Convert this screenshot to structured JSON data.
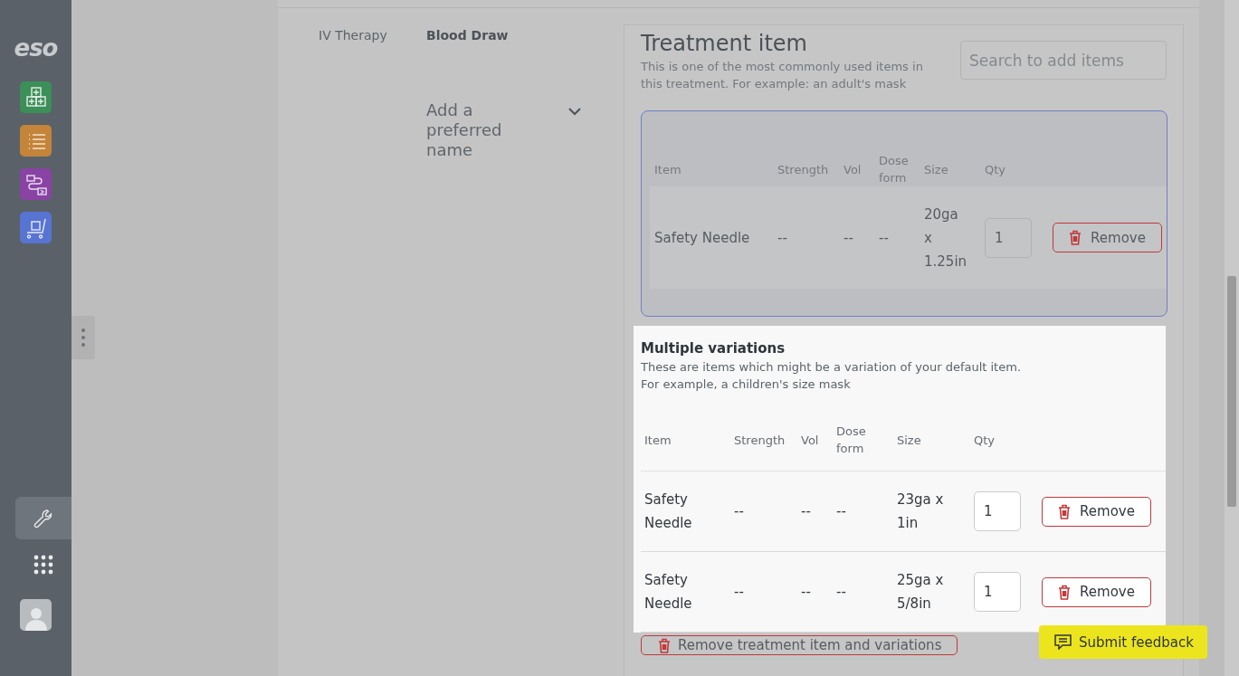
{
  "sidebar": {
    "logo": "eso",
    "apps": [
      {
        "kind": "boxes",
        "color": "#3c8f58"
      },
      {
        "kind": "list",
        "color": "#c4843a"
      },
      {
        "kind": "flow",
        "color": "#8843a3"
      },
      {
        "kind": "cart",
        "color": "#5874d2"
      }
    ],
    "tools": [
      {
        "kind": "wrench",
        "selected": true
      },
      {
        "kind": "grid",
        "selected": false
      }
    ]
  },
  "procedure": {
    "category": "IV Therapy",
    "name": "Blood Draw",
    "preferred_name_dropdown": {
      "placeholder": "Add a preferred name"
    }
  },
  "treatment_item": {
    "title": "Treatment item",
    "description": "This is one of the most commonly used items in this treatment. For example: an adult's mask",
    "search": {
      "placeholder": "Search to add items"
    },
    "columns": [
      "Item",
      "Strength",
      "Vol",
      "Dose form",
      "Size",
      "Qty"
    ],
    "rows": [
      {
        "item": "Safety Needle",
        "strength": "--",
        "vol": "--",
        "dose_form": "--",
        "size": "20ga x 1.25in",
        "qty": "1",
        "button": "Remove"
      }
    ]
  },
  "variations": {
    "title": "Multiple variations",
    "description": [
      "These are items which might be a variation of your default item.",
      "For example, a children's size mask"
    ],
    "columns": [
      "Item",
      "Strength",
      "Vol",
      "Dose form",
      "Size",
      "Qty"
    ],
    "rows": [
      {
        "item": "Safety Needle",
        "strength": "--",
        "vol": "--",
        "dose_form": "--",
        "size": "23ga x 1in",
        "qty": "1",
        "button": "Remove"
      },
      {
        "item": "Safety Needle",
        "strength": "--",
        "vol": "--",
        "dose_form": "--",
        "size": "25ga x 5/8in",
        "qty": "1",
        "button": "Remove"
      }
    ]
  },
  "remove_all_button": "Remove treatment item and variations",
  "feedback_button": "Submit feedback"
}
